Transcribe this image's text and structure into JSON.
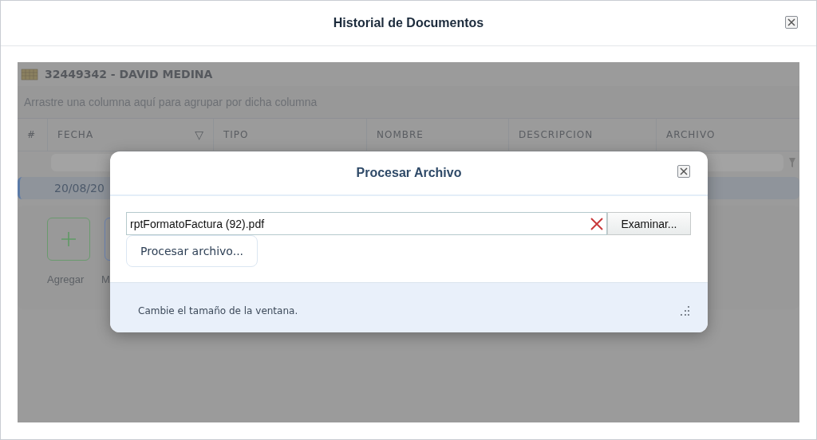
{
  "window": {
    "title": "Historial de Documentos"
  },
  "grid": {
    "title": "32449342 - DAVID MEDINA",
    "group_hint": "Arrastre una columna aquí para agrupar por dicha columna",
    "columns": [
      {
        "label": "#"
      },
      {
        "label": "FECHA",
        "sort_glyph": "▽"
      },
      {
        "label": "TIPO"
      },
      {
        "label": "NOMBRE"
      },
      {
        "label": "DESCRIPCION"
      },
      {
        "label": "ARCHIVO"
      }
    ],
    "rows": [
      {
        "fecha": "20/08/20",
        "selected": true
      }
    ]
  },
  "actions": [
    {
      "label": "Agregar",
      "kind": "add"
    },
    {
      "label": "M",
      "kind": "other"
    }
  ],
  "dialog": {
    "title": "Procesar Archivo",
    "file": {
      "value": "rptFormatoFactura (92).pdf",
      "browse": "Examinar..."
    },
    "process_button": "Procesar archivo...",
    "footer": "Cambie el tamaño de la ventana."
  }
}
